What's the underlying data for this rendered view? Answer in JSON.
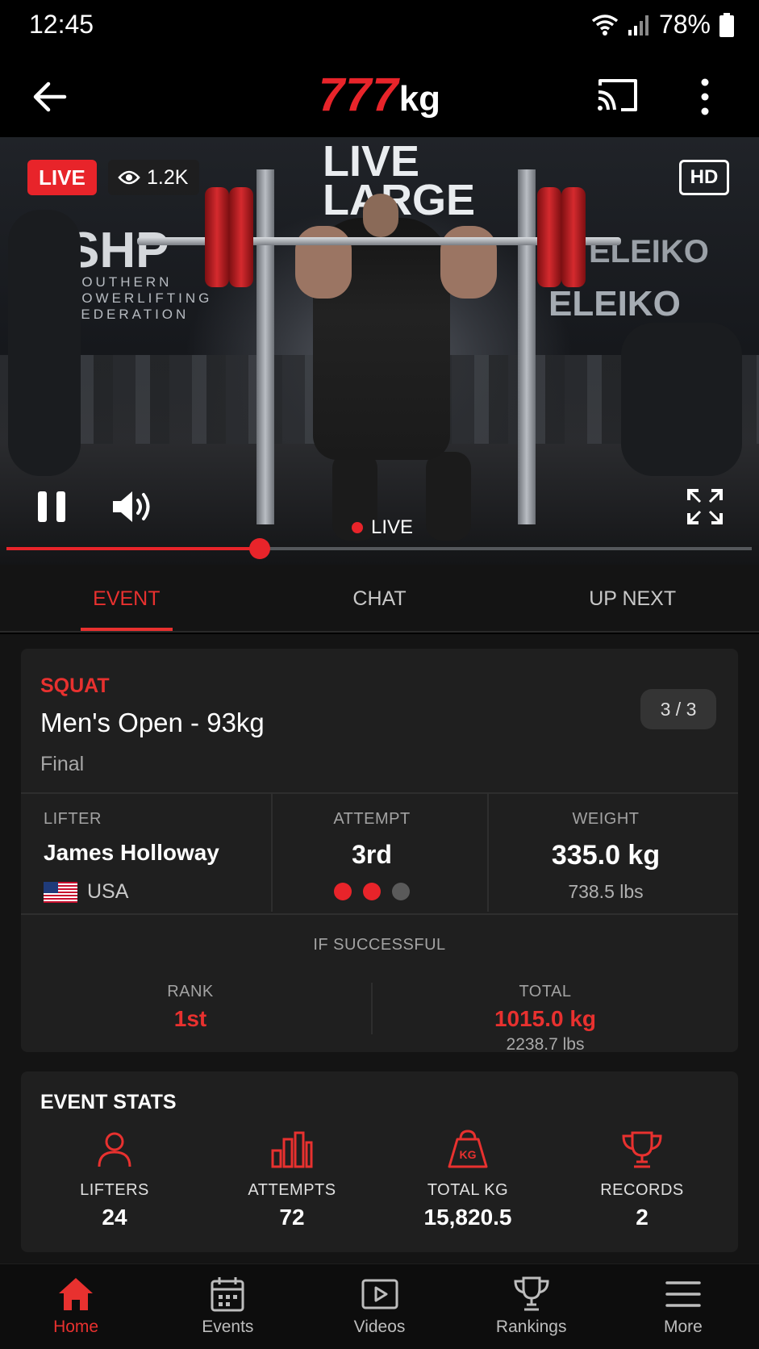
{
  "status_bar": {
    "time": "12:45",
    "battery": "78%"
  },
  "app_bar": {
    "logo_number": "777",
    "logo_unit": "kg"
  },
  "video": {
    "live_badge": "LIVE",
    "viewers": "1.2K",
    "quality": "HD",
    "live_indicator": "LIVE",
    "progress": 0.34,
    "backdrop": {
      "banner_line1": "LIVE",
      "banner_line2": "LARGE",
      "shp": "SHP",
      "shp_line1": "SOUTHERN",
      "shp_line2": "POWERLIFTING",
      "shp_line3": "FEDERATION",
      "eleiko1": "ELEIKO",
      "eleiko2": "ELEIKO"
    }
  },
  "tabs": [
    {
      "label": "EVENT",
      "active": true
    },
    {
      "label": "CHAT",
      "active": false
    },
    {
      "label": "UP NEXT",
      "active": false
    }
  ],
  "event": {
    "type": "SQUAT",
    "title": "Men's Open - 93kg",
    "phase": "Final",
    "round": "3 / 3",
    "lifter_label": "LIFTER",
    "lifter_name": "James Holloway",
    "country": "USA",
    "attempt_label": "ATTEMPT",
    "attempt_value": "3rd",
    "attempt_dots": [
      "#e8242a",
      "#e8242a",
      "#5a5a5a"
    ],
    "weight_label": "WEIGHT",
    "weight_kg": "335.0 kg",
    "weight_lbs": "738.5 lbs",
    "if_successful_label": "IF SUCCESSFUL",
    "rank_label": "RANK",
    "rank_value": "1st",
    "total_label": "TOTAL",
    "total_kg": "1015.0 kg",
    "total_lbs": "2238.7 lbs"
  },
  "stats": {
    "title": "EVENT STATS",
    "items": [
      {
        "label": "LIFTERS",
        "value": "24",
        "icon": "person-icon"
      },
      {
        "label": "ATTEMPTS",
        "value": "72",
        "icon": "bar-chart-icon"
      },
      {
        "label": "TOTAL KG",
        "value": "15,820.5",
        "icon": "kettlebell-icon",
        "icon_text": "KG"
      },
      {
        "label": "RECORDS",
        "value": "2",
        "icon": "trophy-icon"
      }
    ]
  },
  "bottom_nav": [
    {
      "label": "Home",
      "active": true,
      "icon": "home-icon"
    },
    {
      "label": "Events",
      "active": false,
      "icon": "calendar-icon"
    },
    {
      "label": "Videos",
      "active": false,
      "icon": "play-icon"
    },
    {
      "label": "Rankings",
      "active": false,
      "icon": "trophy-icon"
    },
    {
      "label": "More",
      "active": false,
      "icon": "menu-icon"
    }
  ],
  "colors": {
    "accent": "#e8242a",
    "background": "#141414",
    "card": "#1f1f1f"
  }
}
